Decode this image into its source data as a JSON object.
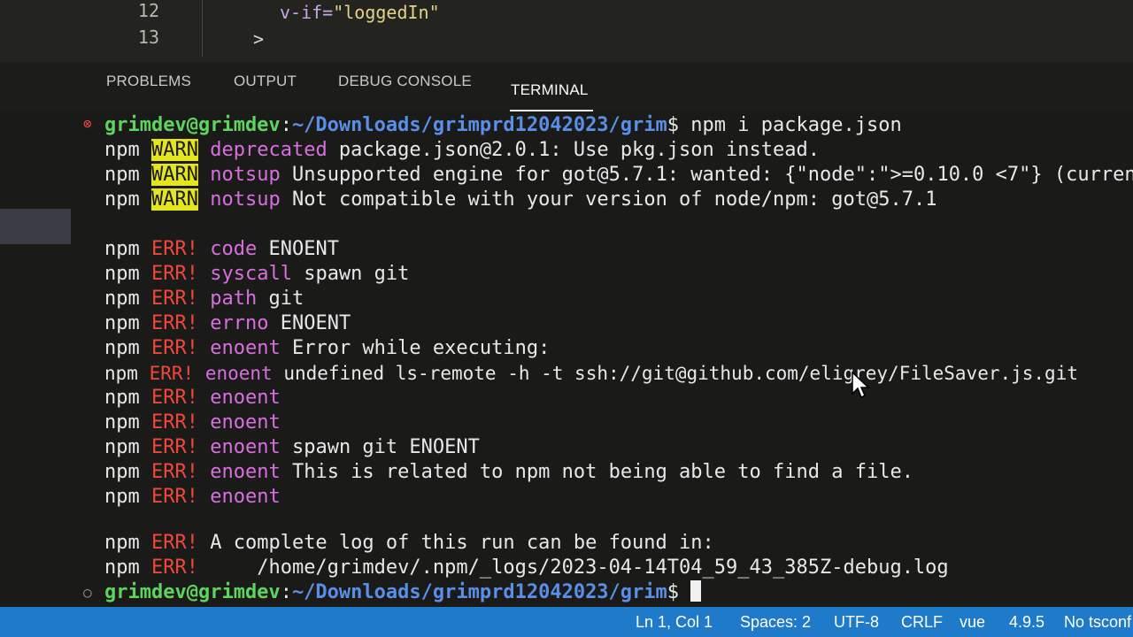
{
  "editor": {
    "lines": [
      {
        "number": "12",
        "text_prefix": "v-if=",
        "text_value": "\"loggedIn\""
      },
      {
        "number": "13",
        "text": ">"
      }
    ]
  },
  "panel": {
    "tabs": [
      "PROBLEMS",
      "OUTPUT",
      "DEBUG CONSOLE",
      "TERMINAL"
    ],
    "active_tab": "TERMINAL"
  },
  "terminal": {
    "prompt_user": "grimdev@grimdev",
    "prompt_sep": ":",
    "prompt_path": "~/Downloads/grimprd12042023/grim",
    "prompt_dollar": "$",
    "command": " npm i package.json",
    "npm": "npm",
    "warn_tag": "WARN",
    "err_tag": "ERR!",
    "warn_lines": [
      {
        "keyword": "deprecated",
        "message": " package.json@2.0.1: Use pkg.json instead."
      },
      {
        "keyword": "notsup",
        "message": " Unsupported engine for got@5.7.1: wanted: {\"node\":\">=0.10.0 <7\"} (curren"
      },
      {
        "keyword": "notsup",
        "message": " Not compatible with your version of node/npm: got@5.7.1"
      }
    ],
    "err_lines": [
      {
        "keyword": "code",
        "message": " ENOENT"
      },
      {
        "keyword": "syscall",
        "message": " spawn git"
      },
      {
        "keyword": "path",
        "message": " git"
      },
      {
        "keyword": "errno",
        "message": " ENOENT"
      },
      {
        "keyword": "enoent",
        "message": " Error while executing:"
      },
      {
        "keyword": "enoent",
        "message": " undefined ls-remote -h -t ssh://git@github.com/eligrey/FileSaver.js.git"
      },
      {
        "keyword": "enoent",
        "message": ""
      },
      {
        "keyword": "enoent",
        "message": ""
      },
      {
        "keyword": "enoent",
        "message": " spawn git ENOENT"
      },
      {
        "keyword": "enoent",
        "message": " This is related to npm not being able to find a file."
      },
      {
        "keyword": "enoent",
        "message": ""
      }
    ],
    "log_lines": [
      " A complete log of this run can be found in:",
      "     /home/grimdev/.npm/_logs/2023-04-14T04_59_43_385Z-debug.log"
    ]
  },
  "statusbar": {
    "position": "Ln 1, Col 1",
    "spaces": "Spaces: 2",
    "encoding": "UTF-8",
    "eol": "CRLF",
    "language": "vue",
    "version": "4.9.5",
    "tsconfig": "No tsconf"
  },
  "colors": {
    "status_bar": "#1f7ac9",
    "warn_bg": "#e4e41f",
    "err": "#f0463c",
    "keyword": "#d86ee0",
    "prompt_user": "#5ed35e",
    "prompt_path": "#5a8ee8"
  },
  "icons": {
    "error_status": "error-circle-icon",
    "idle_status": "circle-outline-icon",
    "mouse": "mouse-pointer-icon"
  }
}
